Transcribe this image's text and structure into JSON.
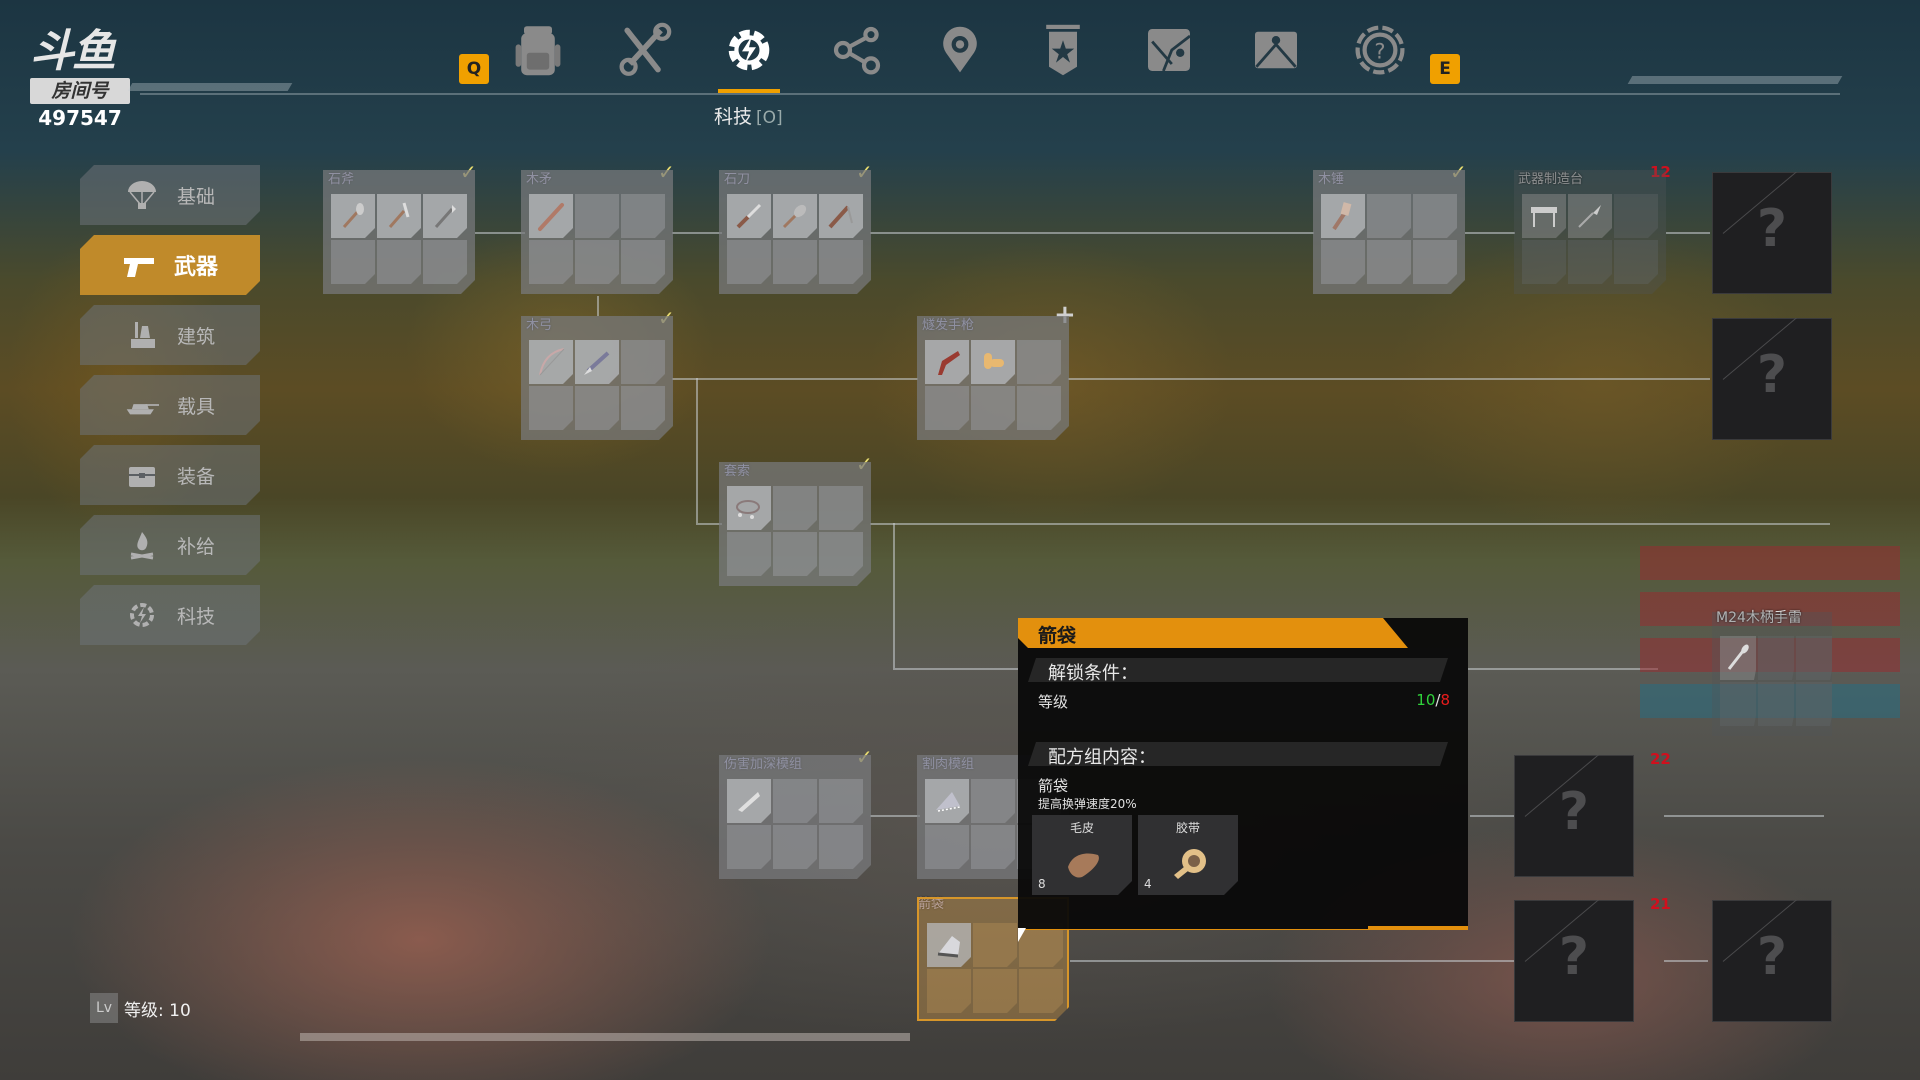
{
  "logo": {
    "brand": "斗鱼",
    "room_label": "房间号",
    "room_number": "497547"
  },
  "topnav": {
    "left_key": "Q",
    "right_key": "E",
    "tabs": [
      {
        "id": "backpack",
        "icon": "backpack-icon"
      },
      {
        "id": "crafting",
        "icon": "wrench-screwdriver-icon"
      },
      {
        "id": "tech",
        "icon": "gear-bolt-icon",
        "active": true
      },
      {
        "id": "share",
        "icon": "share-nodes-icon"
      },
      {
        "id": "location",
        "icon": "map-pin-icon"
      },
      {
        "id": "badge",
        "icon": "star-banner-icon"
      },
      {
        "id": "map",
        "icon": "map-icon"
      },
      {
        "id": "mail",
        "icon": "mail-icon"
      },
      {
        "id": "help",
        "icon": "help-icon"
      }
    ],
    "active_label": "科技",
    "active_hint": "[O]"
  },
  "sidebar": {
    "items": [
      {
        "label": "基础",
        "icon": "parachute-icon"
      },
      {
        "label": "武器",
        "icon": "pistol-icon",
        "active": true
      },
      {
        "label": "建筑",
        "icon": "building-icon"
      },
      {
        "label": "载具",
        "icon": "tank-icon"
      },
      {
        "label": "装备",
        "icon": "chest-icon"
      },
      {
        "label": "补给",
        "icon": "campfire-icon"
      },
      {
        "label": "科技",
        "icon": "gear-bolt-icon"
      }
    ]
  },
  "tree": {
    "nodes": [
      {
        "title": "石斧",
        "status": "unlocked",
        "items": [
          "stone-axe",
          "stone-pickaxe",
          "stone-spear"
        ]
      },
      {
        "title": "木矛",
        "status": "unlocked",
        "items": [
          "wooden-spear"
        ]
      },
      {
        "title": "石刀",
        "status": "unlocked",
        "items": [
          "stone-knife",
          "stone-club",
          "stone-sickle"
        ]
      },
      {
        "title": "木锤",
        "status": "unlocked",
        "items": [
          "wooden-hammer"
        ]
      },
      {
        "title": "武器制造台",
        "status": "locked",
        "required_level": "12",
        "items": [
          "workbench",
          "iron-spear"
        ]
      },
      {
        "title": "木弓",
        "status": "unlocked",
        "items": [
          "wooden-bow",
          "arrow"
        ]
      },
      {
        "title": "燧发手枪",
        "status": "available",
        "items": [
          "flintlock-pistol",
          "bullets"
        ]
      },
      {
        "title": "套索",
        "status": "unlocked",
        "items": [
          "lasso"
        ]
      },
      {
        "title": "伤害加深模组",
        "status": "unlocked",
        "items": [
          "blade-mod"
        ]
      },
      {
        "title": "割肉模组",
        "status": "available",
        "items": [
          "saw-mod"
        ]
      },
      {
        "title": "箭袋",
        "status": "selected",
        "items": [
          "quiver"
        ]
      },
      {
        "title": "M24木柄手雷",
        "status": "locked",
        "items": [
          "stick-grenade"
        ]
      }
    ],
    "locked_unknown": [
      {
        "label": "?",
        "required_level": ""
      },
      {
        "label": "?",
        "required_level": ""
      },
      {
        "label": "?",
        "required_level": "22"
      },
      {
        "label": "?",
        "required_level": "21"
      },
      {
        "label": "?",
        "required_level": ""
      }
    ]
  },
  "tooltip": {
    "title": "箭袋",
    "unlock_heading": "解锁条件：",
    "level_label": "等级",
    "level_current": "10",
    "level_separator": "/",
    "level_required": "8",
    "recipe_heading": "配方组内容：",
    "recipe_name": "箭袋",
    "recipe_desc": "提高换弹速度20%",
    "materials": [
      {
        "name": "毛皮",
        "count": "8",
        "icon": "fur-icon"
      },
      {
        "name": "胶带",
        "count": "4",
        "icon": "tape-icon"
      }
    ]
  },
  "player": {
    "level_badge": "Lv",
    "level_text": "等级: 10"
  },
  "colors": {
    "accent": "#f0a000",
    "active_tab": "#c08a2a",
    "ok": "#2fd23a",
    "fail": "#e81b1b"
  }
}
